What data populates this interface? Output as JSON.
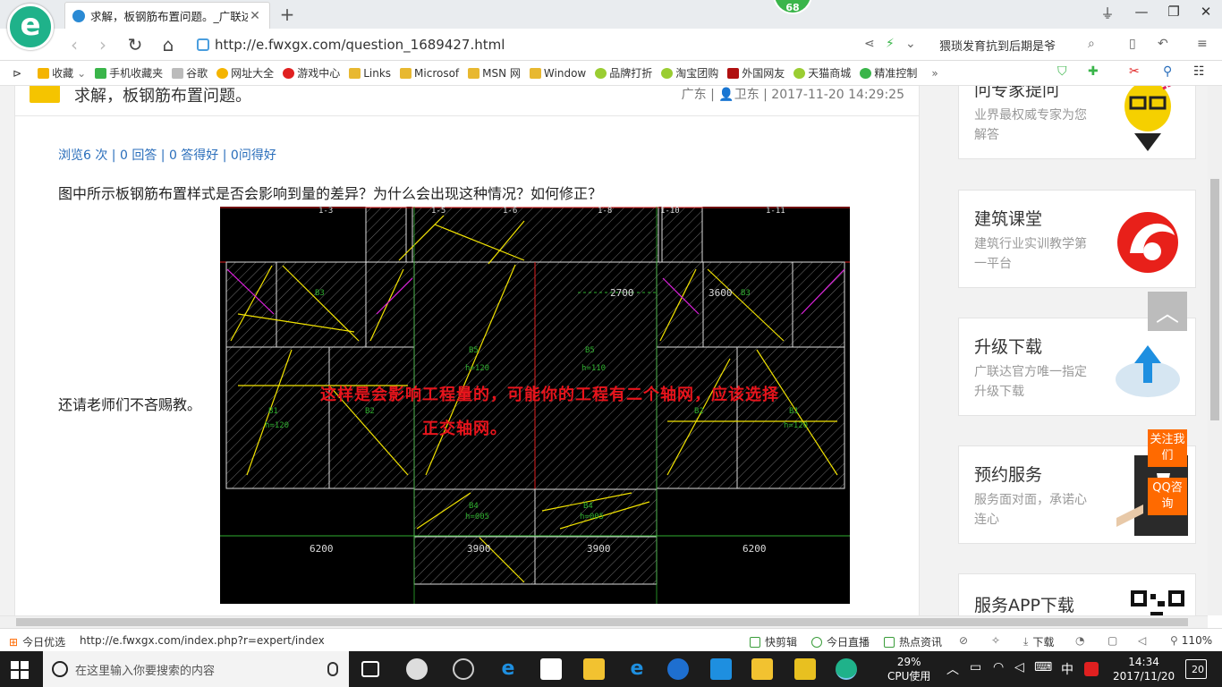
{
  "tab": {
    "title": "求解，板钢筋布置问题。_广联达",
    "close": "✕",
    "new": "+"
  },
  "badge": "68",
  "window": {
    "shirt": "⏚",
    "min": "—",
    "max": "❐",
    "close": "✕"
  },
  "address": {
    "back": "‹",
    "forward": "›",
    "refresh": "↻",
    "home": "⌂",
    "url": "http://e.fwxgx.com/question_1689427.html",
    "search_text": "猥琐发育抗到后期是爷"
  },
  "bookmarks": [
    {
      "label": "收藏",
      "color": "#f4b400"
    },
    {
      "label": "手机收藏夹",
      "color": "#3ab54a"
    },
    {
      "label": "谷歌",
      "color": "#bbbbbb"
    },
    {
      "label": "网址大全",
      "color": "#f4b400"
    },
    {
      "label": "游戏中心",
      "color": "#e02020"
    },
    {
      "label": "Links",
      "color": "#e8b830"
    },
    {
      "label": "Microsof",
      "color": "#e8b830"
    },
    {
      "label": "MSN 网",
      "color": "#e8b830"
    },
    {
      "label": "Window",
      "color": "#e8b830"
    },
    {
      "label": "品牌打折",
      "color": "#9acd32"
    },
    {
      "label": "淘宝团购",
      "color": "#9acd32"
    },
    {
      "label": "外国网友",
      "color": "#b01010"
    },
    {
      "label": "天猫商城",
      "color": "#9acd32"
    },
    {
      "label": "精准控制",
      "color": "#3ab54a"
    }
  ],
  "bookmarks_more": "»",
  "question": {
    "title": "求解，板钢筋布置问题。",
    "meta": "广东 | 👤卫东 | 2017-11-20 14:29:25",
    "stats": "浏览6 次 | 0 回答 | 0 答得好 | 0问得好",
    "body": "图中所示板钢筋布置样式是否会影响到量的差异？为什么会出现这种情况？如何修正？",
    "plea": "还请老师们不吝赐教。"
  },
  "cad": {
    "note_line1": "这样是会影响工程量的，可能你的工程有二个轴网，应该选择",
    "note_line2": "正交轴网。",
    "dims": [
      "2700",
      "3600",
      "6200",
      "3900",
      "3900",
      "6200"
    ],
    "slabs": [
      "B5",
      "h=120",
      "B5",
      "h=110",
      "B2",
      "B2",
      "B1",
      "h=120",
      "B1",
      "h=120",
      "B4",
      "h=005",
      "B4",
      "h=005",
      "B3",
      "B3"
    ],
    "axis": [
      "1-3",
      "1-5",
      "1-6",
      "1-8",
      "1-10",
      "1-11"
    ]
  },
  "sidebar": [
    {
      "title": "问专家提问",
      "sub": "业界最权威专家为您解答"
    },
    {
      "title": "建筑课堂",
      "sub": "建筑行业实训教学第一平台"
    },
    {
      "title": "升级下载",
      "sub": "广联达官方唯一指定升级下载"
    },
    {
      "title": "预约服务",
      "sub": "服务面对面，承诺心连心"
    },
    {
      "title": "服务APP下载",
      "sub": ""
    }
  ],
  "fab": {
    "top": "︿",
    "follow": "关注我们",
    "qq": "QQ咨询"
  },
  "status": {
    "today": "今日优选",
    "url": "http://e.fwxgx.com/index.php?r=expert/index",
    "items": [
      "快剪辑",
      "今日直播",
      "热点资讯",
      "下载"
    ],
    "zoom": "110%"
  },
  "taskbar": {
    "search_placeholder": "在这里输入你要搜索的内容",
    "cpu_pct": "29%",
    "cpu_label": "CPU使用",
    "ime": "中",
    "time": "14:34",
    "date": "2017/11/20",
    "notif": "20"
  }
}
